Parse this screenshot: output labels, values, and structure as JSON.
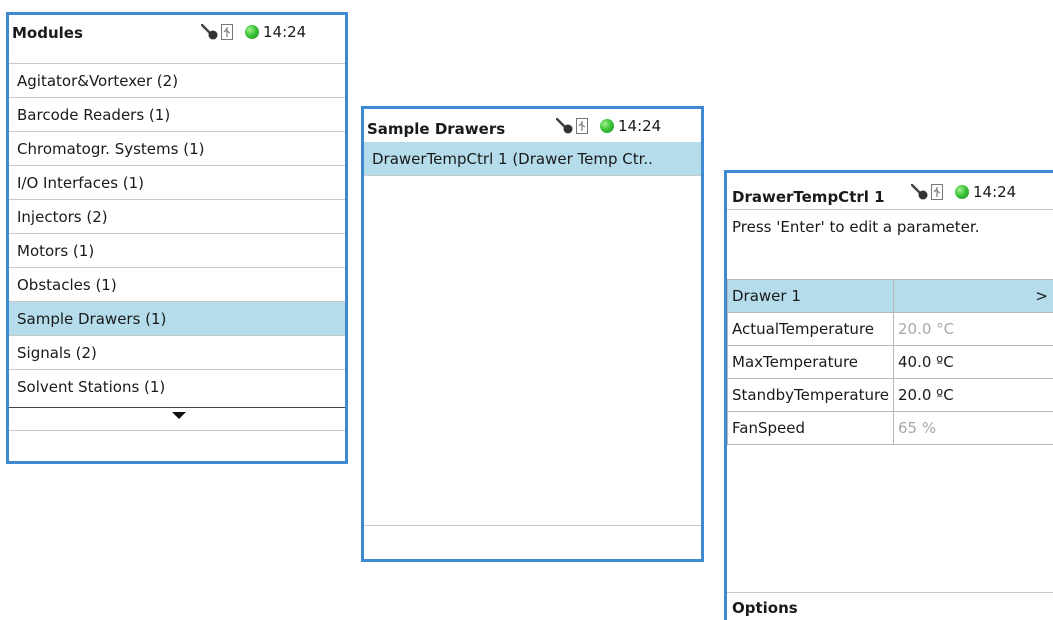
{
  "status": {
    "time": "14:24",
    "time_cut": "14:24",
    "icons": [
      "key-icon",
      "usb-icon",
      "status-led-icon"
    ],
    "led_color": "#3bc43a"
  },
  "modules": {
    "title": "Modules",
    "items": [
      {
        "label": "Agitator&Vortexer (2)"
      },
      {
        "label": "Barcode Readers (1)"
      },
      {
        "label": "Chromatogr. Systems (1)"
      },
      {
        "label": "I/O Interfaces (1)"
      },
      {
        "label": "Injectors (2)"
      },
      {
        "label": "Motors (1)"
      },
      {
        "label": "Obstacles (1)"
      },
      {
        "label": "Sample Drawers (1)"
      },
      {
        "label": "Signals (2)"
      },
      {
        "label": "Solvent Stations (1)"
      }
    ],
    "selected_index": 7
  },
  "sample_drawers": {
    "title": "Sample Drawers",
    "items": [
      {
        "label": "DrawerTempCtrl 1 (Drawer Temp Ctr.."
      }
    ]
  },
  "drawer_ctrl": {
    "title": "DrawerTempCtrl 1",
    "hint": "Press 'Enter' to edit a parameter.",
    "group": {
      "label": "Drawer 1",
      "arrow": ">"
    },
    "params": [
      {
        "name": "ActualTemperature",
        "value": "20.0 °C"
      },
      {
        "name": "MaxTemperature",
        "value": "40.0 ºC"
      },
      {
        "name": "StandbyTemperature",
        "value": "20.0 ºC"
      },
      {
        "name": "FanSpeed",
        "value": "65 %"
      }
    ],
    "options_label": "Options"
  },
  "colors": {
    "frame": "#3f89d3",
    "selection": "#b4dcea",
    "muted_value": "#a8a8a8"
  }
}
